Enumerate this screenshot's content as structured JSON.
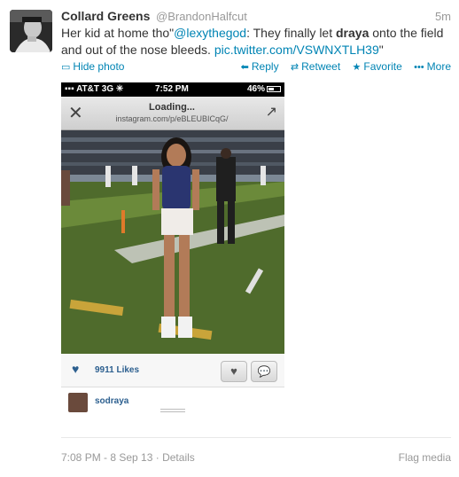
{
  "tweet": {
    "fullname": "Collard Greens",
    "username": "@BrandonHalfcut",
    "time": "5m",
    "text": {
      "part1": "Her kid at home tho\"",
      "mention": "@lexythegod",
      "part2": ": They finally let ",
      "bold": "draya",
      "part3": " onto the field and out of the nose bleeds. ",
      "link": "pic.twitter.com/VSWNXTLH39",
      "part4": "\""
    }
  },
  "actions": {
    "hide_photo": "Hide photo",
    "reply": "Reply",
    "retweet": "Retweet",
    "favorite": "Favorite",
    "more": "More"
  },
  "screenshot": {
    "status": {
      "carrier": "AT&T",
      "network": "3G",
      "clock": "7:52 PM",
      "battery": "46%"
    },
    "nav": {
      "title": "Loading...",
      "url": "instagram.com/p/eBLEUBICqG/"
    },
    "likes": "9911 Likes",
    "comment_user": "sodraya"
  },
  "footer": {
    "timestamp": "7:08 PM - 8 Sep 13",
    "separator": "·",
    "details": "Details",
    "flag": "Flag media"
  },
  "colors": {
    "link": "#0084b4",
    "insta_blue": "#2c5f8f",
    "muted": "#999999"
  }
}
